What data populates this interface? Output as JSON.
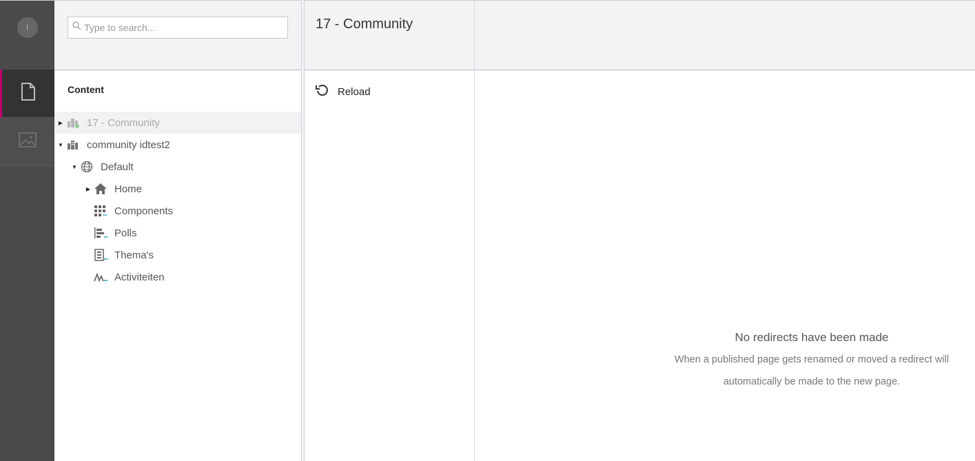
{
  "user": {
    "initial": "I"
  },
  "rail": {
    "items": [
      {
        "icon": "document-icon",
        "active": true
      },
      {
        "icon": "image-icon",
        "active": false
      }
    ]
  },
  "search": {
    "placeholder": "Type to search...",
    "value": ""
  },
  "tree": {
    "title": "Content",
    "items": [
      {
        "label": "17 - Community",
        "icon": "community-site-icon",
        "selected": true,
        "expanded": false
      },
      {
        "label": "community idtest2",
        "icon": "community-site-icon",
        "selected": false,
        "expanded": true
      },
      {
        "label": "Default",
        "icon": "globe-icon",
        "expanded": true
      },
      {
        "label": "Home",
        "icon": "home-icon",
        "expanded": false
      },
      {
        "label": "Components",
        "icon": "grid-icon"
      },
      {
        "label": "Polls",
        "icon": "polls-icon"
      },
      {
        "label": "Thema's",
        "icon": "themes-icon"
      },
      {
        "label": "Activiteiten",
        "icon": "activity-icon"
      }
    ]
  },
  "middle": {
    "title": "17 - Community",
    "reload_label": "Reload"
  },
  "main": {
    "empty_title": "No redirects have been made",
    "empty_line1": "When a published page gets renamed or moved a redirect will",
    "empty_line2": "automatically be made to the new page."
  },
  "colors": {
    "accent": "#c4006b",
    "rail": "#4a4a4a",
    "header": "#f3f3f5"
  }
}
